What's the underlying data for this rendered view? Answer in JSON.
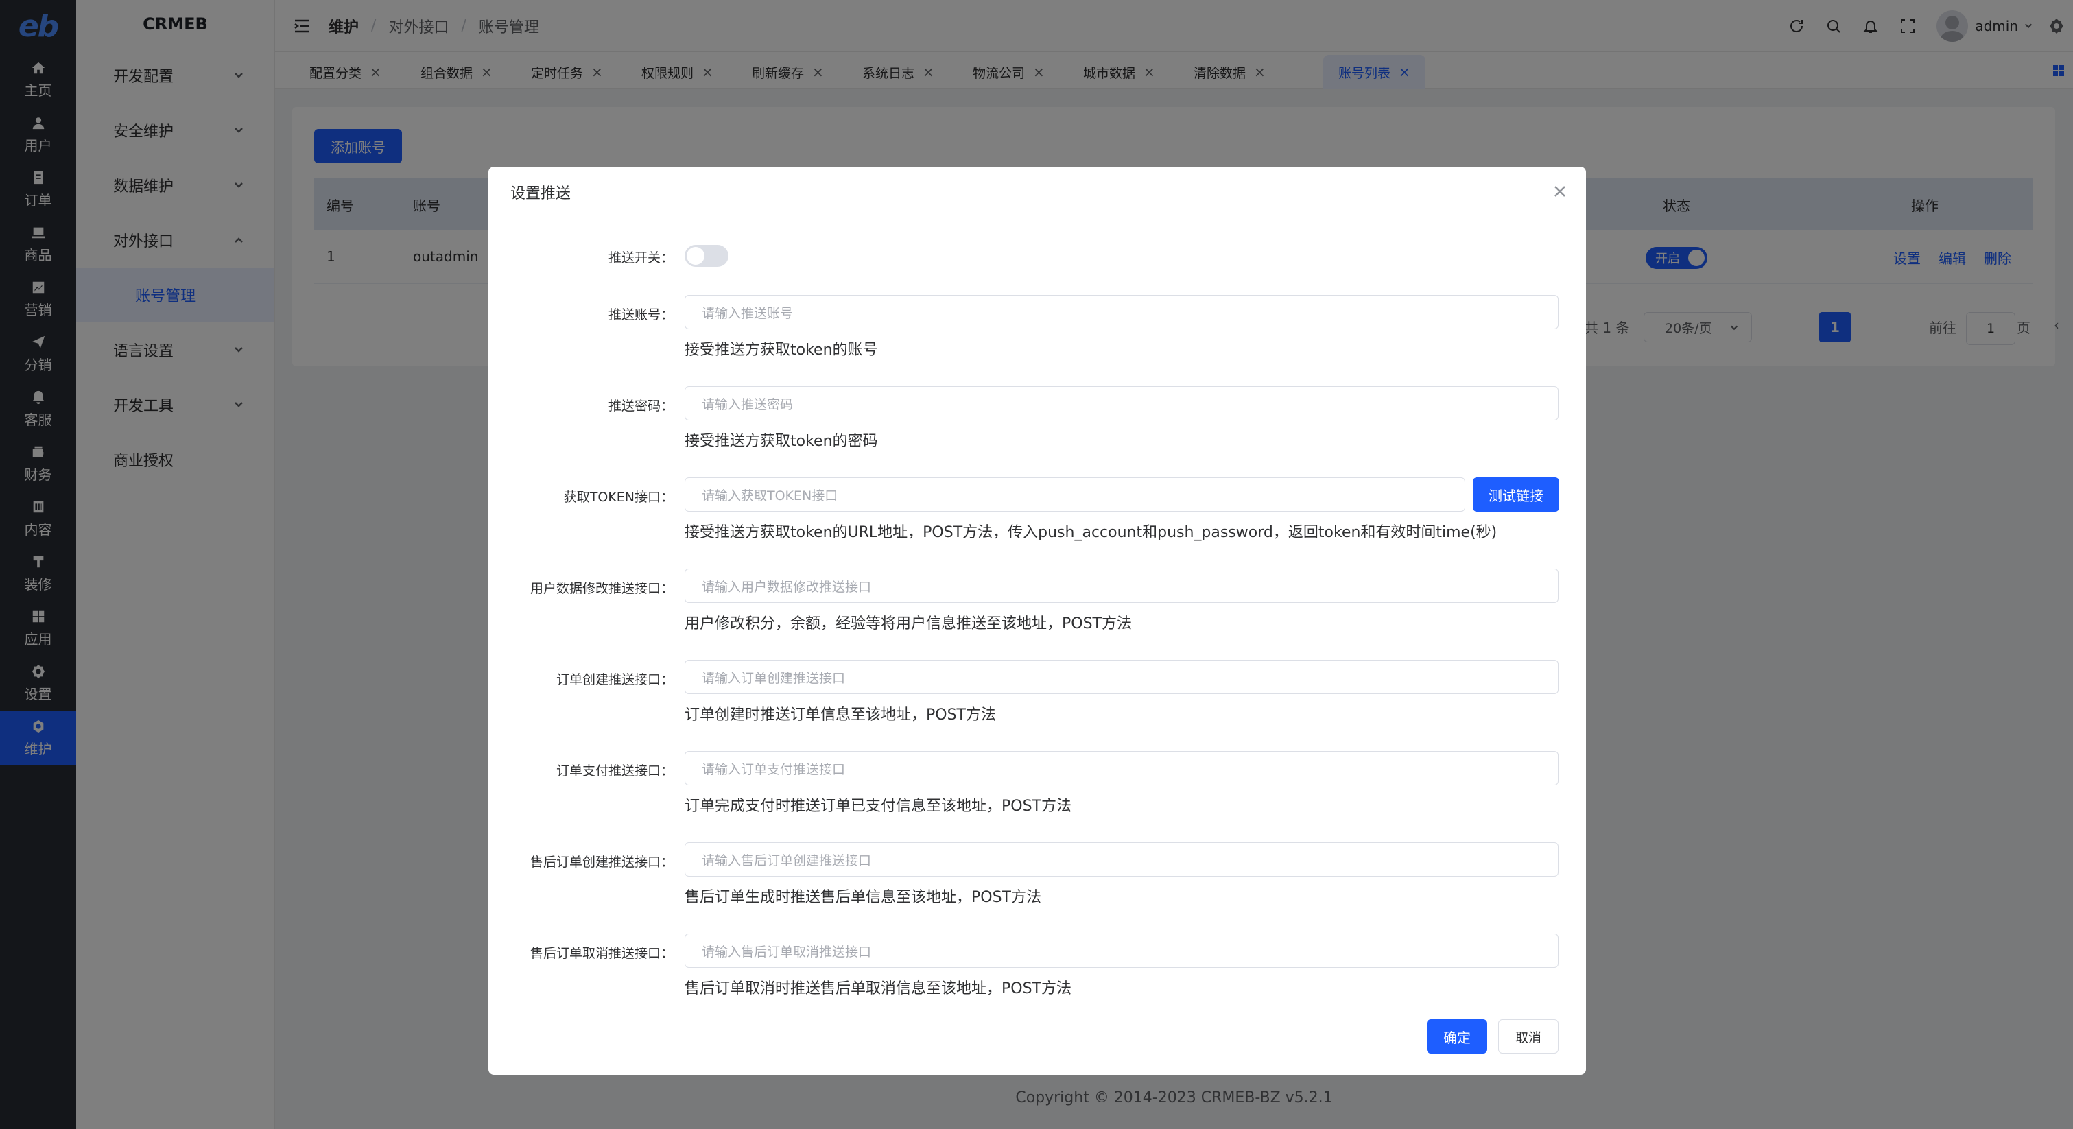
{
  "app": {
    "brand": "CRMEB",
    "logo": "eb"
  },
  "rail": [
    {
      "label": "主页",
      "icon": "home-icon"
    },
    {
      "label": "用户",
      "icon": "user-icon"
    },
    {
      "label": "订单",
      "icon": "order-icon"
    },
    {
      "label": "商品",
      "icon": "product-icon"
    },
    {
      "label": "营销",
      "icon": "marketing-icon"
    },
    {
      "label": "分销",
      "icon": "distribution-icon"
    },
    {
      "label": "客服",
      "icon": "service-icon"
    },
    {
      "label": "财务",
      "icon": "finance-icon"
    },
    {
      "label": "内容",
      "icon": "content-icon"
    },
    {
      "label": "装修",
      "icon": "decorate-icon"
    },
    {
      "label": "应用",
      "icon": "apps-icon"
    },
    {
      "label": "设置",
      "icon": "settings-icon"
    },
    {
      "label": "维护",
      "icon": "maintenance-icon"
    }
  ],
  "submenu": {
    "items": [
      "开发配置",
      "安全维护",
      "数据维护",
      "对外接口",
      "语言设置",
      "开发工具",
      "商业授权"
    ],
    "active_child": "账号管理"
  },
  "breadcrumb": {
    "level1": "维护",
    "level2": "对外接口",
    "level3": "账号管理",
    "sep": "/"
  },
  "header": {
    "user": "admin"
  },
  "tabs": [
    "配置分类",
    "组合数据",
    "定时任务",
    "权限规则",
    "刷新缓存",
    "系统日志",
    "物流公司",
    "城市数据",
    "清除数据",
    "账号列表"
  ],
  "toolbar": {
    "add_label": "添加账号"
  },
  "table": {
    "columns": {
      "id": "编号",
      "account": "账号",
      "status": "状态",
      "ops": "操作"
    },
    "row": {
      "id": "1",
      "account": "outadmin",
      "status": "开启",
      "op_set": "设置",
      "op_edit": "编辑",
      "op_delete": "删除"
    }
  },
  "pagination": {
    "total": "共 1 条",
    "page_size": "20条/页",
    "current": "1",
    "goto_prefix": "前往",
    "goto_value": "1",
    "goto_suffix": "页"
  },
  "footer": {
    "copyright": "Copyright © 2014-2023 CRMEB-BZ v5.2.1"
  },
  "modal": {
    "title": "设置推送",
    "switch_label": "推送开关：",
    "fields": [
      {
        "label": "推送账号：",
        "placeholder": "请输入推送账号",
        "hint": "接受推送方获取token的账号"
      },
      {
        "label": "推送密码：",
        "placeholder": "请输入推送密码",
        "hint": "接受推送方获取token的密码"
      },
      {
        "label": "获取TOKEN接口：",
        "placeholder": "请输入获取TOKEN接口",
        "hint": "接受推送方获取token的URL地址，POST方法，传入push_account和push_password，返回token和有效时间time(秒)"
      },
      {
        "label": "用户数据修改推送接口：",
        "placeholder": "请输入用户数据修改推送接口",
        "hint": "用户修改积分，余额，经验等将用户信息推送至该地址，POST方法"
      },
      {
        "label": "订单创建推送接口：",
        "placeholder": "请输入订单创建推送接口",
        "hint": "订单创建时推送订单信息至该地址，POST方法"
      },
      {
        "label": "订单支付推送接口：",
        "placeholder": "请输入订单支付推送接口",
        "hint": "订单完成支付时推送订单已支付信息至该地址，POST方法"
      },
      {
        "label": "售后订单创建推送接口：",
        "placeholder": "请输入售后订单创建推送接口",
        "hint": "售后订单生成时推送售后单信息至该地址，POST方法"
      },
      {
        "label": "售后订单取消推送接口：",
        "placeholder": "请输入售后订单取消推送接口",
        "hint": "售后订单取消时推送售后单取消信息至该地址，POST方法"
      }
    ],
    "test_label": "测试链接",
    "ok_label": "确定",
    "cancel_label": "取消"
  },
  "colors": {
    "primary": "#1e5eff",
    "rail_bg": "#282c34",
    "overlay": "rgba(0,0,0,0.5)"
  }
}
